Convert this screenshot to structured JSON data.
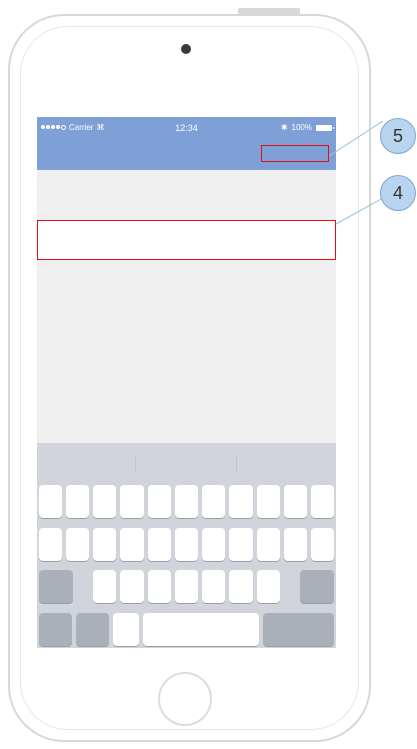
{
  "status_bar": {
    "carrier": "Carrier",
    "time": "12:34",
    "battery": "100%",
    "wifi_icon": "wifi-icon",
    "bluetooth_icon": "bluetooth-icon"
  },
  "callouts": {
    "top": "5",
    "field": "4"
  },
  "colors": {
    "nav_bar": "#7ea0d6",
    "highlight": "#e01010",
    "callout_fill": "#b8d4ee",
    "screen_bg": "#efefef",
    "keyboard_bg": "#d1d5db"
  }
}
